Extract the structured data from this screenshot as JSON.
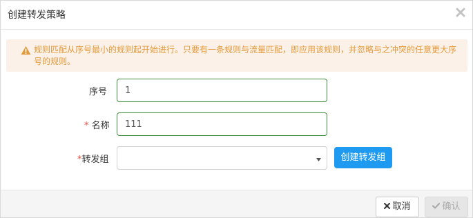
{
  "dialog": {
    "title": "创建转发策略"
  },
  "alert": {
    "icon": "warning-icon",
    "color": "#e39a3a",
    "background": "#fcf1e8",
    "text": "规则匹配从序号最小的规则起开始进行。只要有一条规则与流量匹配，即应用该规则，并忽略与之冲突的任意更大序号的规则。"
  },
  "form": {
    "seq": {
      "label": "序号",
      "value": "1"
    },
    "name": {
      "required_mark": "*",
      "label": "名称",
      "value": "111"
    },
    "group": {
      "required_mark": "*",
      "label": "转发组",
      "value": ""
    },
    "create_group_button": "创建转发组"
  },
  "footer": {
    "cancel_label": "取消",
    "confirm_label": "确认"
  },
  "colors": {
    "primary": "#1e9bf0",
    "required": "#e74c3c",
    "input_border_active": "#3c8b3c"
  }
}
